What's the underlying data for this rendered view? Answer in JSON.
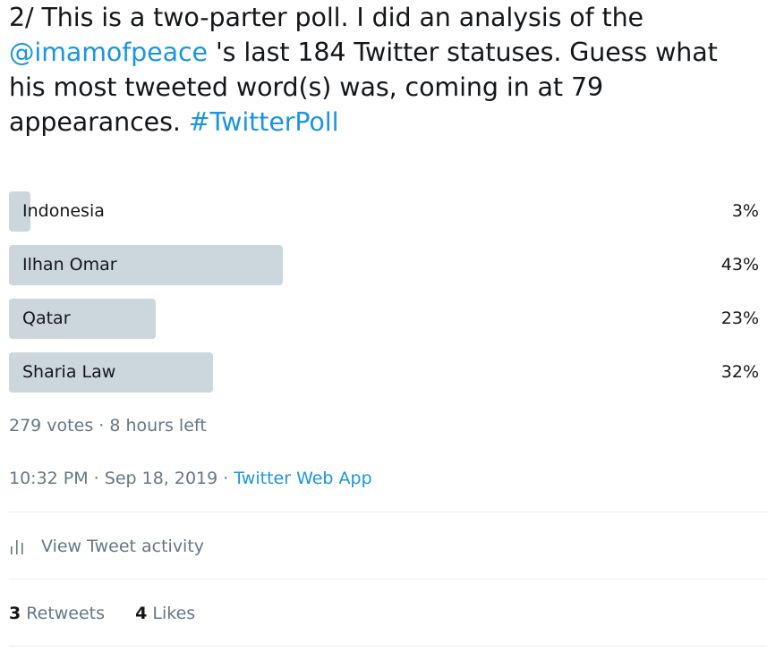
{
  "tweet": {
    "text_before": "2/ This is a two-parter poll. I did an analysis of the ",
    "mention": "@imamofpeace",
    "text_middle": " 's last 184 Twitter statuses. Guess what his most tweeted word(s) was, coming in at 79 appearances. ",
    "hashtag": "#TwitterPoll"
  },
  "poll": {
    "options": [
      {
        "label": "Indonesia",
        "percent_text": "3%",
        "percent": 3
      },
      {
        "label": "Ilhan Omar",
        "percent_text": "43%",
        "percent": 43
      },
      {
        "label": "Qatar",
        "percent_text": "23%",
        "percent": 23
      },
      {
        "label": "Sharia Law",
        "percent_text": "32%",
        "percent": 32
      }
    ],
    "meta": "279 votes · 8 hours left"
  },
  "timestamp": {
    "time_date": "10:32 PM · Sep 18, 2019 · ",
    "source": "Twitter Web App"
  },
  "activity": {
    "label": "View Tweet activity",
    "icon": "bar-chart-icon"
  },
  "stats": {
    "retweets_count": "3",
    "retweets_label": "Retweets",
    "likes_count": "4",
    "likes_label": "Likes"
  },
  "colors": {
    "link": "#1b95e0",
    "bar": "#ccd6dd",
    "muted": "#657786",
    "text": "#14171a"
  }
}
